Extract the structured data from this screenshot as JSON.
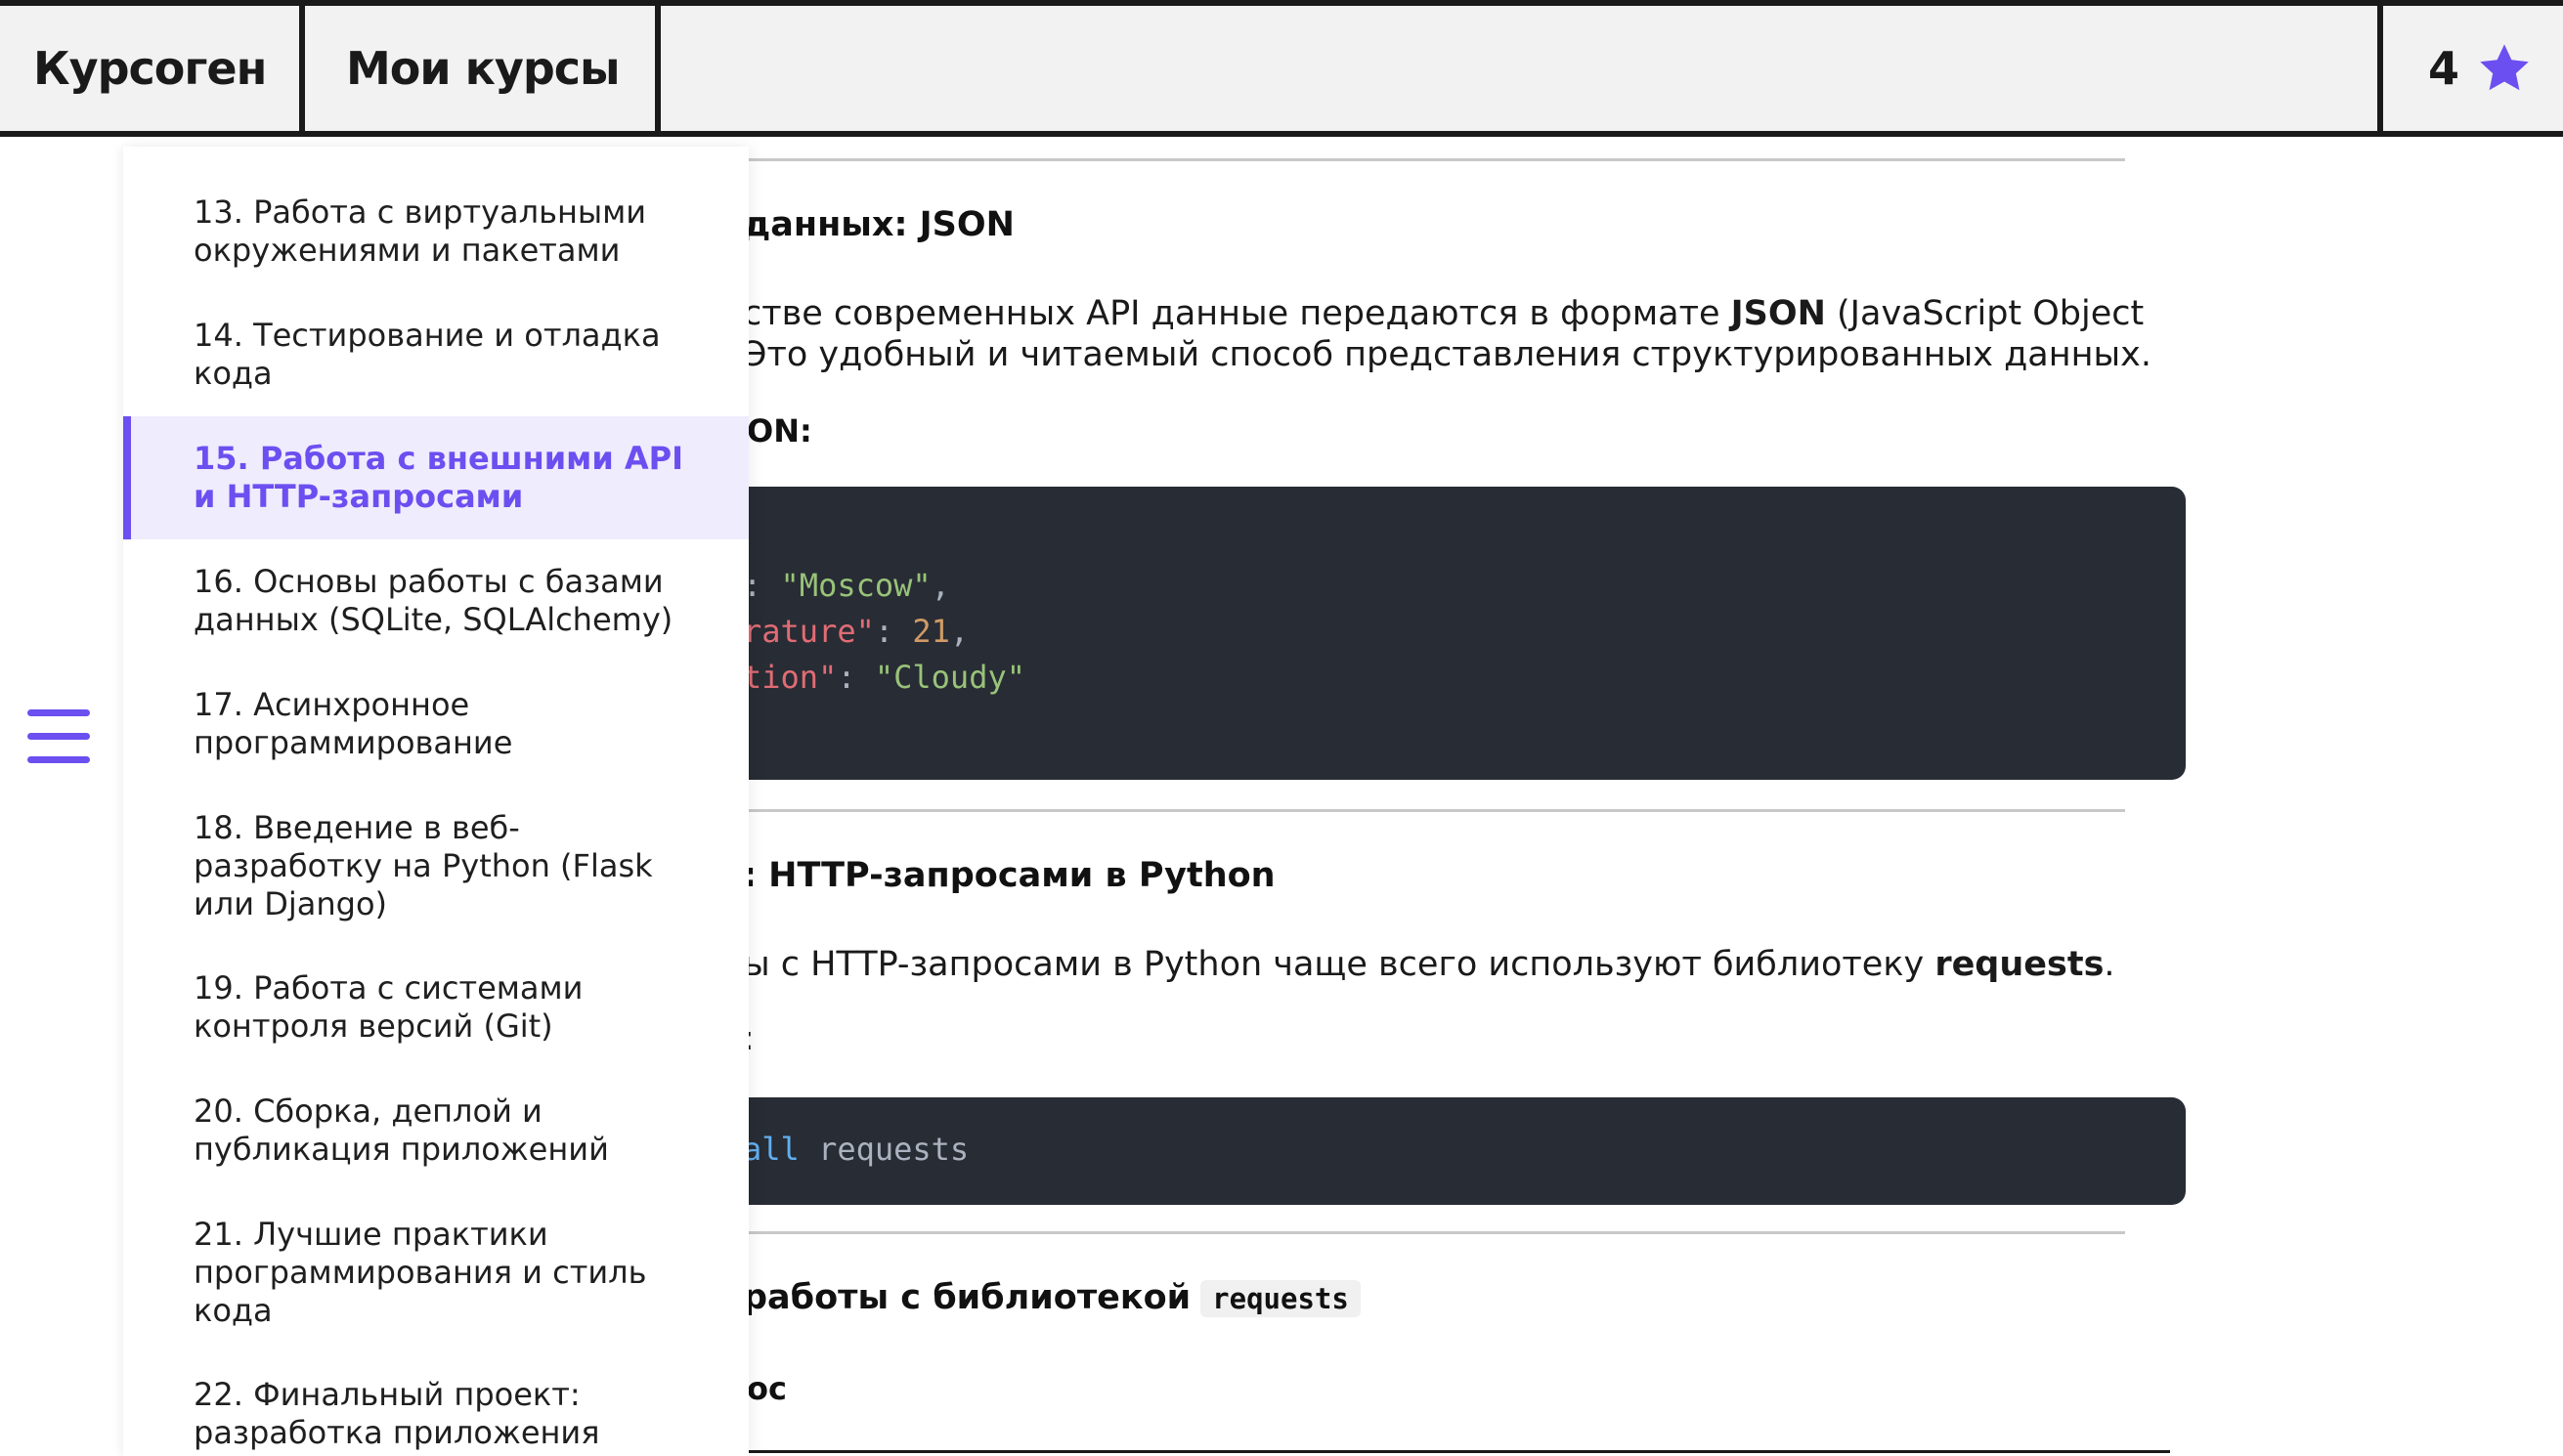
{
  "header": {
    "logo": "Курсоген",
    "my_courses": "Мои курсы",
    "score": "4",
    "score_icon": "star-icon",
    "accent": "#6c4ff0"
  },
  "sidebar": {
    "items": [
      {
        "label": "13. Работа с виртуальными окружениями и пакетами",
        "active": false
      },
      {
        "label": "14. Тестирование и отладка кода",
        "active": false
      },
      {
        "label": "15. Работа с внешними API и HTTP-запросами",
        "active": true
      },
      {
        "label": "16. Основы работы с базами данных (SQLite, SQLAlchemy)",
        "active": false
      },
      {
        "label": "17. Асинхронное программирование",
        "active": false
      },
      {
        "label": "18. Введение в веб-разработку на Python (Flask или Django)",
        "active": false
      },
      {
        "label": "19. Работа с системами контроля версий (Git)",
        "active": false
      },
      {
        "label": "20. Сборка, деплой и публикация приложений",
        "active": false
      },
      {
        "label": "21. Лучшие практики программирования и стиль кода",
        "active": false
      },
      {
        "label": "22. Финальный проект: разработка приложения",
        "active": false
      }
    ]
  },
  "content": {
    "json_heading": "данных: JSON",
    "json_para_1_a": "стве современных API данные передаются в формате ",
    "json_para_1_b": "JSON",
    "json_para_1_c": " (JavaScript Object",
    "json_para_2": "Это удобный и читаемый способ представления структурированных данных.",
    "json_example_label": "ON:",
    "code1": {
      "l1_a": ": ",
      "l1_b": "\"Moscow\"",
      "l1_c": ",",
      "l2_a": "rature\"",
      "l2_b": ": ",
      "l2_c": "21",
      "l2_d": ",",
      "l3_a": "tion\"",
      "l3_b": ": ",
      "l3_c": "\"Cloudy\""
    },
    "http_heading": ": HTTP-запросами в Python",
    "http_para_a": "ы с HTTP-запросами в Python чаще всего используют библиотеку ",
    "http_para_b": "requests",
    "http_para_c": ".",
    "install_label": ":",
    "code2": {
      "kw": "all",
      "rest": " requests"
    },
    "requests_heading": "работы с библиотекой",
    "requests_inline": "requests",
    "subheading": "ос"
  }
}
